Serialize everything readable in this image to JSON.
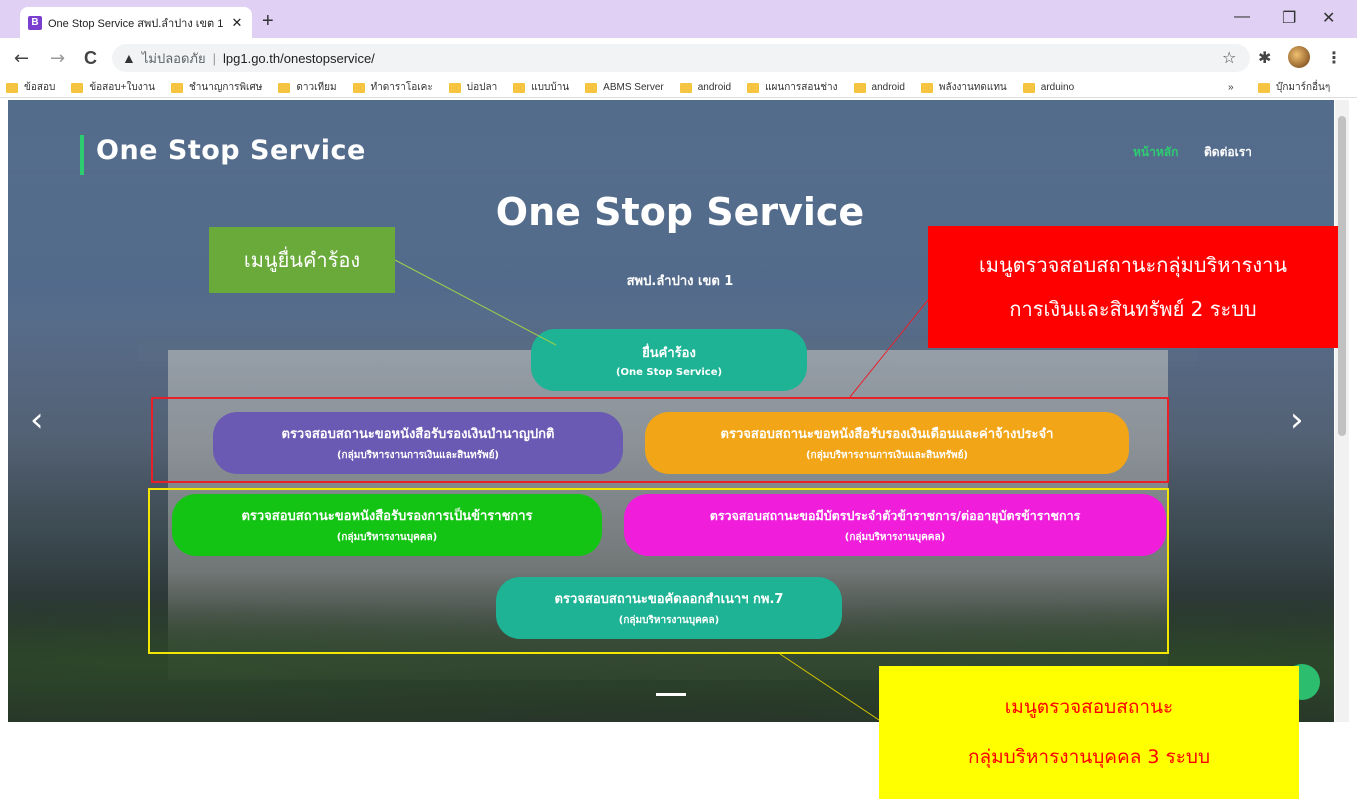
{
  "browser": {
    "tab_title": "One Stop Service สพป.ลำปาง เขต 1",
    "tab_favicon": "B",
    "tab_close": "✕",
    "new_tab": "+",
    "win_minimize": "—",
    "win_restore": "❐",
    "win_close": "✕",
    "back": "←",
    "forward": "→",
    "reload": "C",
    "security_warning_icon": "▲",
    "security_text": "ไม่ปลอดภัย",
    "url_separator": "|",
    "url": "lpg1.go.th/onestopservice/",
    "star": "☆",
    "extensions": "✱",
    "menu": "⋮",
    "bookmarks": [
      "ข้อสอบ",
      "ข้อสอบ+ใบงาน",
      "ชำนาญการพิเศษ",
      "ดาวเทียม",
      "ทำดาราโอเคะ",
      "บ่อปลา",
      "แบบบ้าน",
      "ABMS Server",
      "android",
      "แผนการสอนช่าง",
      "android",
      "พลังงานทดแทน",
      "arduino"
    ],
    "bookmarks_more": "»",
    "other_bookmarks": "บุ๊กมาร์กอื่นๆ"
  },
  "site": {
    "brand": "One Stop Service",
    "nav_home": "หน้าหลัก",
    "nav_contact": "ติดต่อเรา",
    "hero_title": "One Stop Service",
    "hero_subtitle": "สพป.ลำปาง เขต 1",
    "arrow_prev": "‹",
    "arrow_next": "›"
  },
  "buttons": {
    "submit": {
      "line1": "ยื่นคำร้อง",
      "line2": "(One Stop Service)",
      "color": "#1db394"
    },
    "pension": {
      "line1": "ตรวจสอบสถานะขอหนังสือรับรองเงินบำนาญปกติ",
      "line2": "(กลุ่มบริหารงานการเงินและสินทรัพย์)",
      "color": "#6a5ab3"
    },
    "salary": {
      "line1": "ตรวจสอบสถานะขอหนังสือรับรองเงินเดือนและค่าจ้างประจำ",
      "line2": "(กลุ่มบริหารงานการเงินและสินทรัพย์)",
      "color": "#f2a516"
    },
    "civil_servant": {
      "line1": "ตรวจสอบสถานะขอหนังสือรับรองการเป็นข้าราชการ",
      "line2": "(กลุ่มบริหารงานบุคคล)",
      "color": "#14c414"
    },
    "id_card": {
      "line1": "ตรวจสอบสถานะขอมีบัตรประจำตัวข้าราชการ/ต่ออายุบัตรข้าราชการ",
      "line2": "(กลุ่มบริหารงานบุคคล)",
      "color": "#f01ddb"
    },
    "kp7": {
      "line1": "ตรวจสอบสถานะขอคัดลอกสำเนาฯ กพ.7",
      "line2": "(กลุ่มบริหารงานบุคคล)",
      "color": "#1db394"
    }
  },
  "annotations": {
    "request_menu": {
      "text": "เมนูยื่นคำร้อง",
      "color": "#6aaa3a"
    },
    "finance_menu": {
      "line1": "เมนูตรวจสอบสถานะกลุ่มบริหารงาน",
      "line2": "การเงินและสินทรัพย์ 2 ระบบ",
      "color": "#ff0000"
    },
    "personnel_menu": {
      "line1": "เมนูตรวจสอบสถานะ",
      "line2": "กลุ่มบริหารงานบุคคล 3 ระบบ",
      "color": "#ffff00"
    }
  }
}
